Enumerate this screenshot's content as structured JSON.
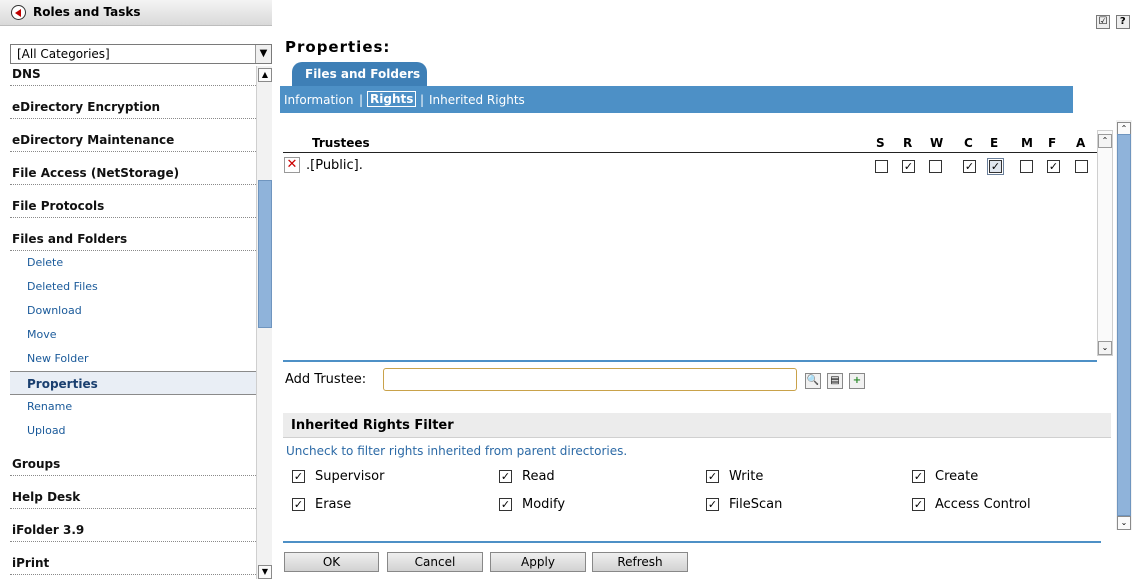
{
  "nav": {
    "header_title": "Roles and Tasks",
    "category_select": "[All Categories]",
    "items": [
      {
        "type": "cat",
        "label": "DNS"
      },
      {
        "type": "cat",
        "label": "eDirectory Encryption"
      },
      {
        "type": "cat",
        "label": "eDirectory Maintenance"
      },
      {
        "type": "cat",
        "label": "File Access (NetStorage)"
      },
      {
        "type": "cat",
        "label": "File Protocols"
      },
      {
        "type": "cat",
        "label": "Files and Folders"
      },
      {
        "type": "task",
        "label": "Delete"
      },
      {
        "type": "task",
        "label": "Deleted Files"
      },
      {
        "type": "task",
        "label": "Download"
      },
      {
        "type": "task",
        "label": "Move"
      },
      {
        "type": "task",
        "label": "New Folder"
      },
      {
        "type": "task",
        "label": "Properties",
        "active": true
      },
      {
        "type": "task",
        "label": "Rename"
      },
      {
        "type": "task",
        "label": "Upload"
      },
      {
        "type": "cat",
        "label": "Groups"
      },
      {
        "type": "cat",
        "label": "Help Desk"
      },
      {
        "type": "cat",
        "label": "iFolder 3.9"
      },
      {
        "type": "cat",
        "label": "iPrint"
      }
    ]
  },
  "header": {
    "page_title": "Properties:",
    "tab_label": "Files and Folders",
    "subnav": {
      "information": "Information",
      "sep1": "|",
      "rights": "Rights",
      "sep2": "|",
      "inherited": "Inherited Rights"
    }
  },
  "trustees": {
    "column_trustees": "Trustees",
    "rights_columns": [
      "S",
      "R",
      "W",
      "C",
      "E",
      "M",
      "F",
      "A"
    ],
    "rows": [
      {
        "name": ".[Public].",
        "checks": [
          false,
          true,
          false,
          true,
          true,
          false,
          true,
          false
        ]
      }
    ]
  },
  "add_trustee": {
    "label": "Add Trustee:",
    "value": ""
  },
  "inherited_filter": {
    "heading": "Inherited Rights Filter",
    "description": "Uncheck to filter rights inherited from parent directories.",
    "items": [
      {
        "label": "Supervisor",
        "checked": true
      },
      {
        "label": "Read",
        "checked": true
      },
      {
        "label": "Write",
        "checked": true
      },
      {
        "label": "Create",
        "checked": true
      },
      {
        "label": "Erase",
        "checked": true
      },
      {
        "label": "Modify",
        "checked": true
      },
      {
        "label": "FileScan",
        "checked": true
      },
      {
        "label": "Access Control",
        "checked": true
      }
    ]
  },
  "buttons": {
    "ok": "OK",
    "cancel": "Cancel",
    "apply": "Apply",
    "refresh": "Refresh"
  },
  "top_icons": {
    "first": "☑",
    "second": "?"
  },
  "icons": {
    "nav_back": "back-arrow-icon",
    "search": "search-icon",
    "browse": "browse-tree-icon",
    "add": "add-icon",
    "delete": "delete-icon"
  }
}
